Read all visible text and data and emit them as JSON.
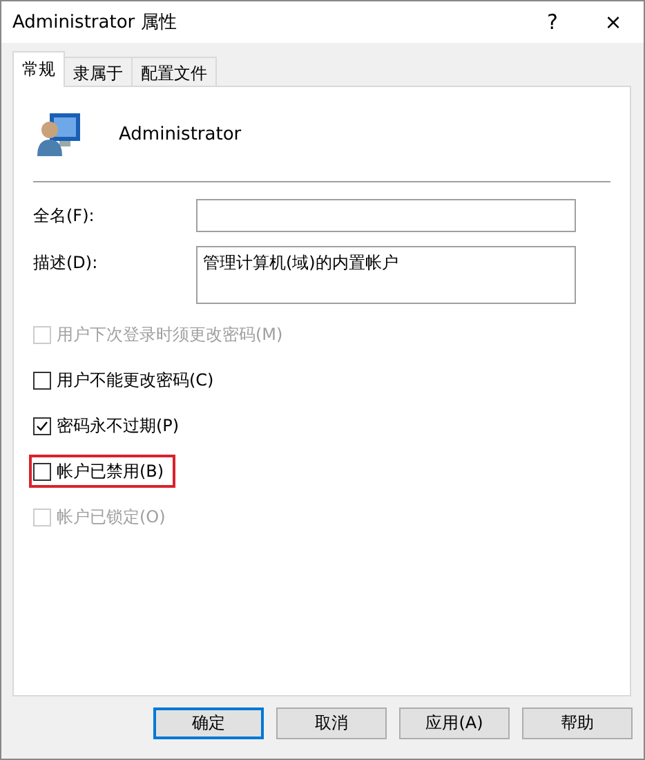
{
  "window": {
    "title": "Administrator 属性",
    "help": "?",
    "close": "×"
  },
  "tabs": [
    {
      "label": "常规",
      "selected": true
    },
    {
      "label": "隶属于",
      "selected": false
    },
    {
      "label": "配置文件",
      "selected": false
    }
  ],
  "user": {
    "name": "Administrator"
  },
  "fields": [
    {
      "label": "全名(F):",
      "multiline": false
    },
    {
      "label": "描述(D):",
      "value": "管理计算机(域)的内置帐户",
      "multiline": true
    }
  ],
  "options": [
    {
      "label": "用户下次登录时须更改密码(M)",
      "checked": false,
      "disabled": true,
      "highlighted": false
    },
    {
      "label": "用户不能更改密码(C)",
      "checked": false,
      "disabled": false,
      "highlighted": false
    },
    {
      "label": "密码永不过期(P)",
      "checked": true,
      "disabled": false,
      "highlighted": false
    },
    {
      "label": "帐户已禁用(B)",
      "checked": false,
      "disabled": false,
      "highlighted": true
    },
    {
      "label": "帐户已锁定(O)",
      "checked": false,
      "disabled": true,
      "highlighted": false
    }
  ],
  "buttons": [
    {
      "label": "确定",
      "default": true
    },
    {
      "label": "取消",
      "default": false
    },
    {
      "label": "应用(A)",
      "default": false
    },
    {
      "label": "帮助",
      "default": false
    }
  ]
}
